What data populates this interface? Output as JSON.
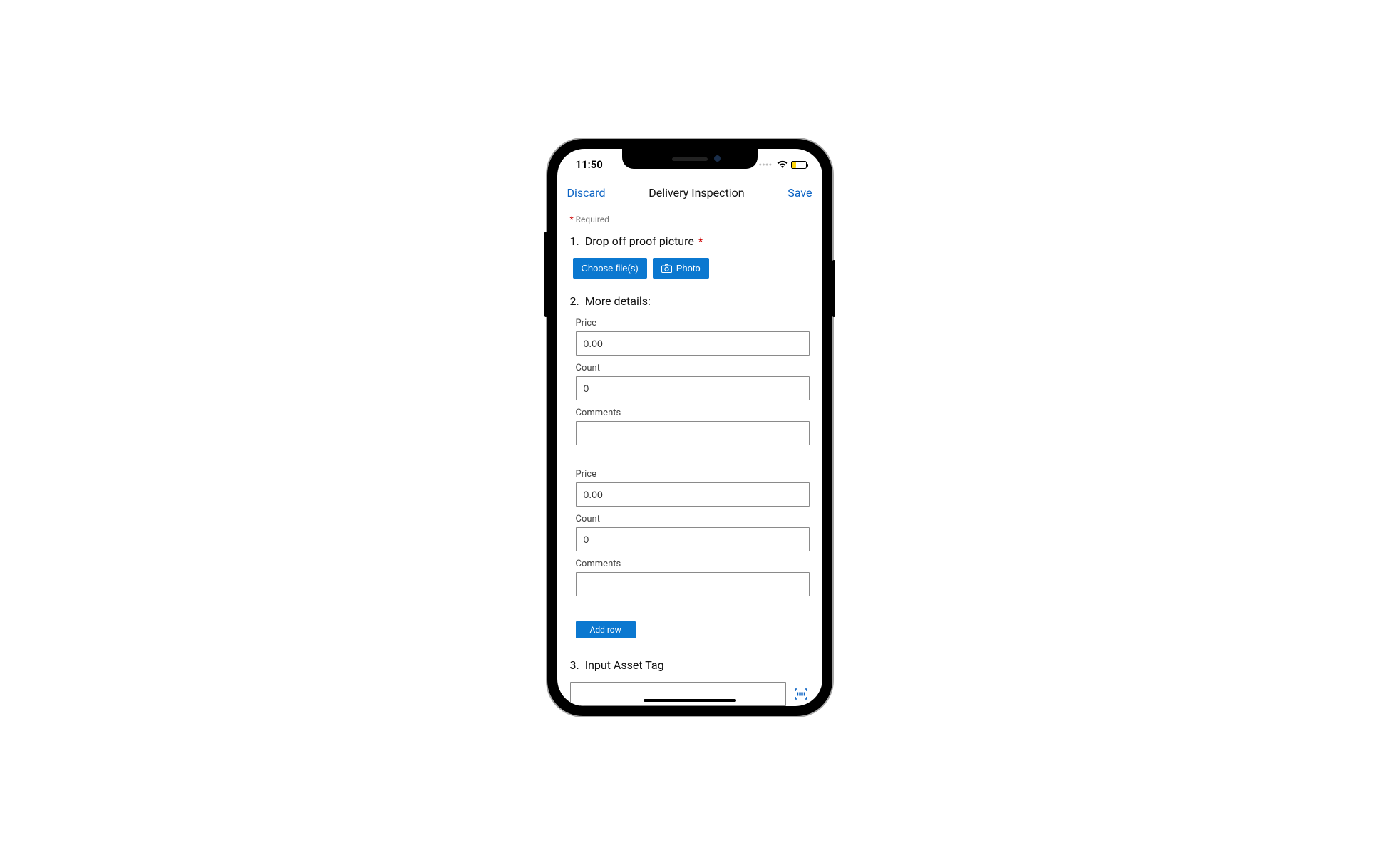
{
  "status": {
    "time": "11:50"
  },
  "nav": {
    "discard": "Discard",
    "title": "Delivery Inspection",
    "save": "Save"
  },
  "required_label": "Required",
  "q1": {
    "num": "1.",
    "title": "Drop off proof picture",
    "choose": "Choose file(s)",
    "photo": "Photo"
  },
  "q2": {
    "num": "2.",
    "title": "More details:",
    "price_label": "Price",
    "count_label": "Count",
    "comments_label": "Comments",
    "rows": [
      {
        "price": "0.00",
        "count": "0",
        "comments": ""
      },
      {
        "price": "0.00",
        "count": "0",
        "comments": ""
      }
    ],
    "add_row": "Add row"
  },
  "q3": {
    "num": "3.",
    "title": "Input Asset Tag",
    "value": ""
  }
}
